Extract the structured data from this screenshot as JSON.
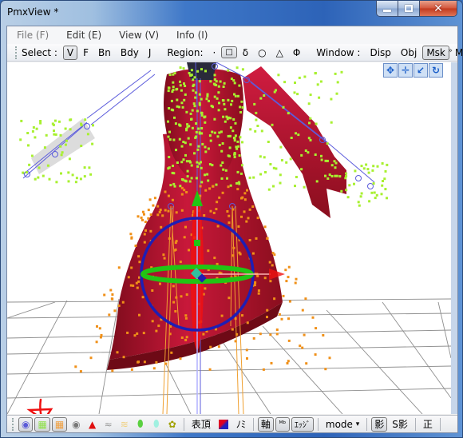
{
  "window": {
    "title": "PmxView *",
    "minimize_icon": "minimize-icon",
    "maximize_icon": "maximize-icon",
    "close_icon": "close-icon"
  },
  "menu": {
    "items": [
      {
        "label": "File (F)",
        "disabled": true
      },
      {
        "label": "Edit (E)",
        "disabled": false
      },
      {
        "label": "View (V)",
        "disabled": false
      },
      {
        "label": "Info (I)",
        "disabled": false
      }
    ]
  },
  "toolbar": {
    "select_label": "Select :",
    "select_items": [
      {
        "label": "V",
        "active": true
      },
      {
        "label": "F",
        "active": false
      },
      {
        "label": "Bn",
        "active": false
      },
      {
        "label": "Bdy",
        "active": false
      },
      {
        "label": "J",
        "active": false
      }
    ],
    "region_label": "Region:",
    "region_items": [
      {
        "label": "·",
        "active": false
      },
      {
        "label": "□",
        "active": true
      },
      {
        "label": "δ",
        "active": false
      },
      {
        "label": "○",
        "active": false
      },
      {
        "label": "△",
        "active": false
      },
      {
        "label": "Φ",
        "active": false
      }
    ],
    "window_label": "Window :",
    "window_items": [
      {
        "label": "Disp",
        "active": false
      },
      {
        "label": "Obj",
        "active": false
      },
      {
        "label": "Msk",
        "active": true
      },
      {
        "label": "Mov",
        "active": false
      }
    ],
    "overflow": "»"
  },
  "gizmo_buttons": [
    {
      "name": "move-view-icon",
      "glyph": "✥"
    },
    {
      "name": "pan-icon",
      "glyph": "✛"
    },
    {
      "name": "zoom-axis-icon",
      "glyph": "↙"
    },
    {
      "name": "rotate-icon",
      "glyph": "↻"
    }
  ],
  "statusbar": {
    "items": [
      {
        "name": "vertex-display-toggle",
        "glyph": "◉",
        "color": "#5a5ad8",
        "active": true
      },
      {
        "name": "vertex-green-toggle",
        "glyph": "▦",
        "color": "#8fe04a",
        "active": true
      },
      {
        "name": "vertex-orange-toggle",
        "glyph": "▦",
        "color": "#f0a040",
        "active": true
      },
      {
        "name": "point-toggle",
        "glyph": "◉",
        "color": "#777777",
        "active": false
      },
      {
        "name": "face-toggle",
        "glyph": "▲",
        "color": "#e01010",
        "active": false
      },
      {
        "name": "edge-gray-toggle",
        "glyph": "≈",
        "color": "#999999",
        "active": false
      },
      {
        "name": "edge-yellow-toggle",
        "glyph": "≋",
        "color": "#f0d080",
        "active": false
      },
      {
        "name": "bone-green-toggle",
        "glyph": "⬮",
        "color": "#5ad040",
        "active": false
      },
      {
        "name": "bone-cyan-toggle",
        "glyph": "⬮",
        "color": "#a0f0e0",
        "active": false
      },
      {
        "name": "joint-toggle",
        "glyph": "✿",
        "color": "#a0a000",
        "active": false
      }
    ],
    "surface_label": "表頂",
    "material_swatch_colors": [
      "#e00020",
      "#2020c0"
    ],
    "normal_label": "ﾉﾐ",
    "axis_label": "軸",
    "mb_label": "ᴹᵇ",
    "edge_label": "ｴｯｼﾞ",
    "mode_label": "mode",
    "mode_arrow": "▾",
    "shadow_label": "影",
    "sshadow_label": "S影",
    "ortho_label": "正"
  },
  "colors": {
    "cloth": "#9c1024",
    "cloth_light": "#c8183a",
    "cloth_dark": "#6e0a16",
    "vertex_green": "#a8f030",
    "vertex_orange": "#f09018",
    "bone": "#6060d8",
    "gizmo_blue": "#1e1eb4",
    "gizmo_green": "#22c414",
    "gizmo_red": "#f01010"
  }
}
